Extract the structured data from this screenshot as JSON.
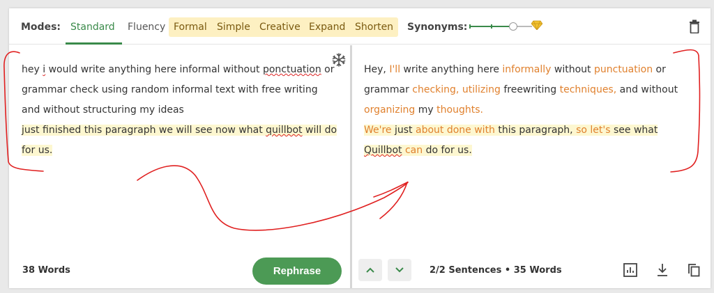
{
  "toolbar": {
    "modes_label": "Modes:",
    "tabs": [
      {
        "label": "Standard",
        "active": true
      },
      {
        "label": "Fluency",
        "active": false
      }
    ],
    "premium_tabs": [
      {
        "label": "Formal"
      },
      {
        "label": "Simple"
      },
      {
        "label": "Creative"
      },
      {
        "label": "Expand"
      },
      {
        "label": "Shorten"
      }
    ],
    "synonyms_label": "Synonyms:",
    "synonyms_level": 0.7
  },
  "input": {
    "p1": "hey ",
    "p1_err1": "i",
    "p2": " would write anything here informal without ",
    "p2_err2": "ponctuation",
    "p3": " or grammar check using random informal text with free writing and without structuring my ideas",
    "p4": "just finished this paragraph we will see now what ",
    "p4_err3": "quillbot",
    "p5": " will do for us.",
    "word_count": "38 Words",
    "rephrase_label": "Rephrase"
  },
  "output": {
    "s1_a": "Hey, ",
    "s1_b": "I'll",
    "s1_c": " write anything here ",
    "s1_d": "informally",
    "s1_e": " without ",
    "s1_f": "punctuation",
    "s1_g": " or grammar ",
    "s1_h": "checking, utilizing",
    "s1_i": " freewriting ",
    "s1_j": "techniques,",
    "s1_k": " and without ",
    "s1_l": "organizing",
    "s1_m": " my ",
    "s1_n": "thoughts.",
    "s2_a": "We're",
    "s2_b": " just ",
    "s2_c": "about done with",
    "s2_d": " this paragraph, ",
    "s2_e": "so let's",
    "s2_f": " see what ",
    "s2_g": "Quillbot",
    "s2_h": " ",
    "s2_i": "can",
    "s2_j": " do for us.",
    "sentences_bold": "2",
    "sentences_rest": "/2 Sentences",
    "bullet": "•",
    "word_count": "35 Words"
  },
  "colors": {
    "accent_green": "#3a8a4a",
    "changed_word": "#e0812e",
    "highlight": "#fdf7d0",
    "premium_bg": "#fdf0c2",
    "annotation_red": "#e02020"
  },
  "icons": [
    "trash-icon",
    "freeze-words-icon",
    "premium-diamond-icon",
    "chevron-up-icon",
    "chevron-down-icon",
    "statistics-icon",
    "download-icon",
    "copy-icon"
  ]
}
